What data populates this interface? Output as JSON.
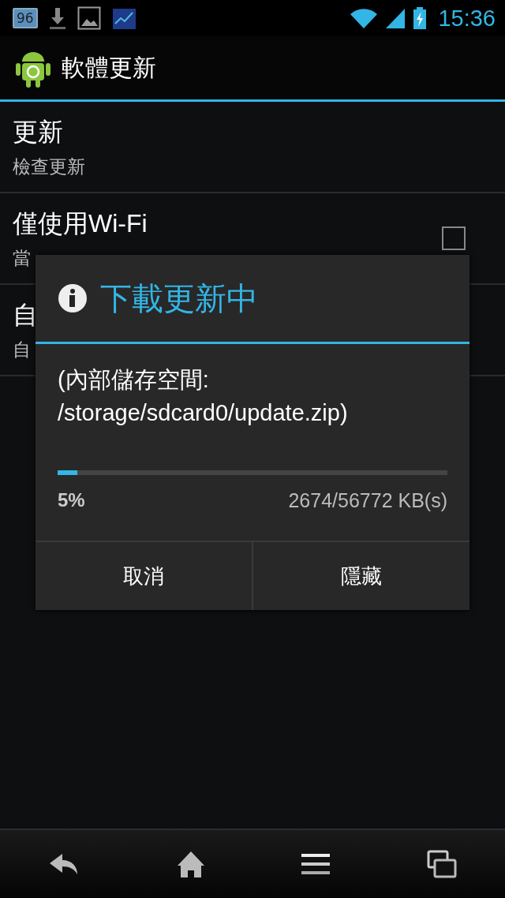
{
  "status_bar": {
    "battery_badge": "96",
    "time": "15:36"
  },
  "action_bar": {
    "title": "軟體更新"
  },
  "preferences": [
    {
      "kind": "plain",
      "title": "更新",
      "summary": "檢查更新"
    },
    {
      "kind": "checkbox",
      "title": "僅使用Wi-Fi",
      "summary": "當",
      "checked": false
    },
    {
      "kind": "plain",
      "title": "自",
      "summary": "自"
    }
  ],
  "dialog": {
    "title": "下載更新中",
    "message": "(內部儲存空間: /storage/sdcard0/update.zip)",
    "progress": {
      "level": 0.05,
      "percent": "5%",
      "amount": "2674/56772 KB(s)"
    },
    "buttons": [
      "取消",
      "隱藏"
    ]
  }
}
